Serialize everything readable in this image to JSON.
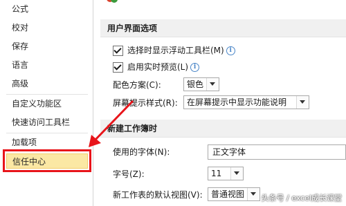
{
  "nav": {
    "items": [
      {
        "label": "公式"
      },
      {
        "label": "校对"
      },
      {
        "label": "保存"
      },
      {
        "label": "语言"
      },
      {
        "label": "高级"
      },
      {
        "label": "自定义功能区"
      },
      {
        "label": "快速访问工具栏"
      },
      {
        "label": "加载项"
      },
      {
        "label": "信任中心"
      }
    ],
    "selected": "信任中心"
  },
  "ui_section": {
    "header": "用户界面选项",
    "floating_toolbar": {
      "label": "选择时显示浮动工具栏(M)",
      "checked": true
    },
    "live_preview": {
      "label": "启用实时预览(L)",
      "checked": true
    },
    "color_scheme": {
      "label": "配色方案(C):",
      "value": "银色"
    },
    "screen_tip": {
      "label": "屏幕提示样式(R):",
      "value": "在屏幕提示中显示功能说明"
    }
  },
  "new_workbook": {
    "header": "新建工作簿时",
    "font": {
      "label": "使用的字体(N):",
      "value": "正文字体"
    },
    "font_size": {
      "label": "字号(Z):",
      "value": "11"
    },
    "default_view": {
      "label": "新工作表的默认视图(V):",
      "value": "普通视图"
    }
  },
  "watermark": "头条号 / excel成长课堂",
  "colors": {
    "accent_red": "#e8141a",
    "selected_bg": "#fbe8a4"
  }
}
